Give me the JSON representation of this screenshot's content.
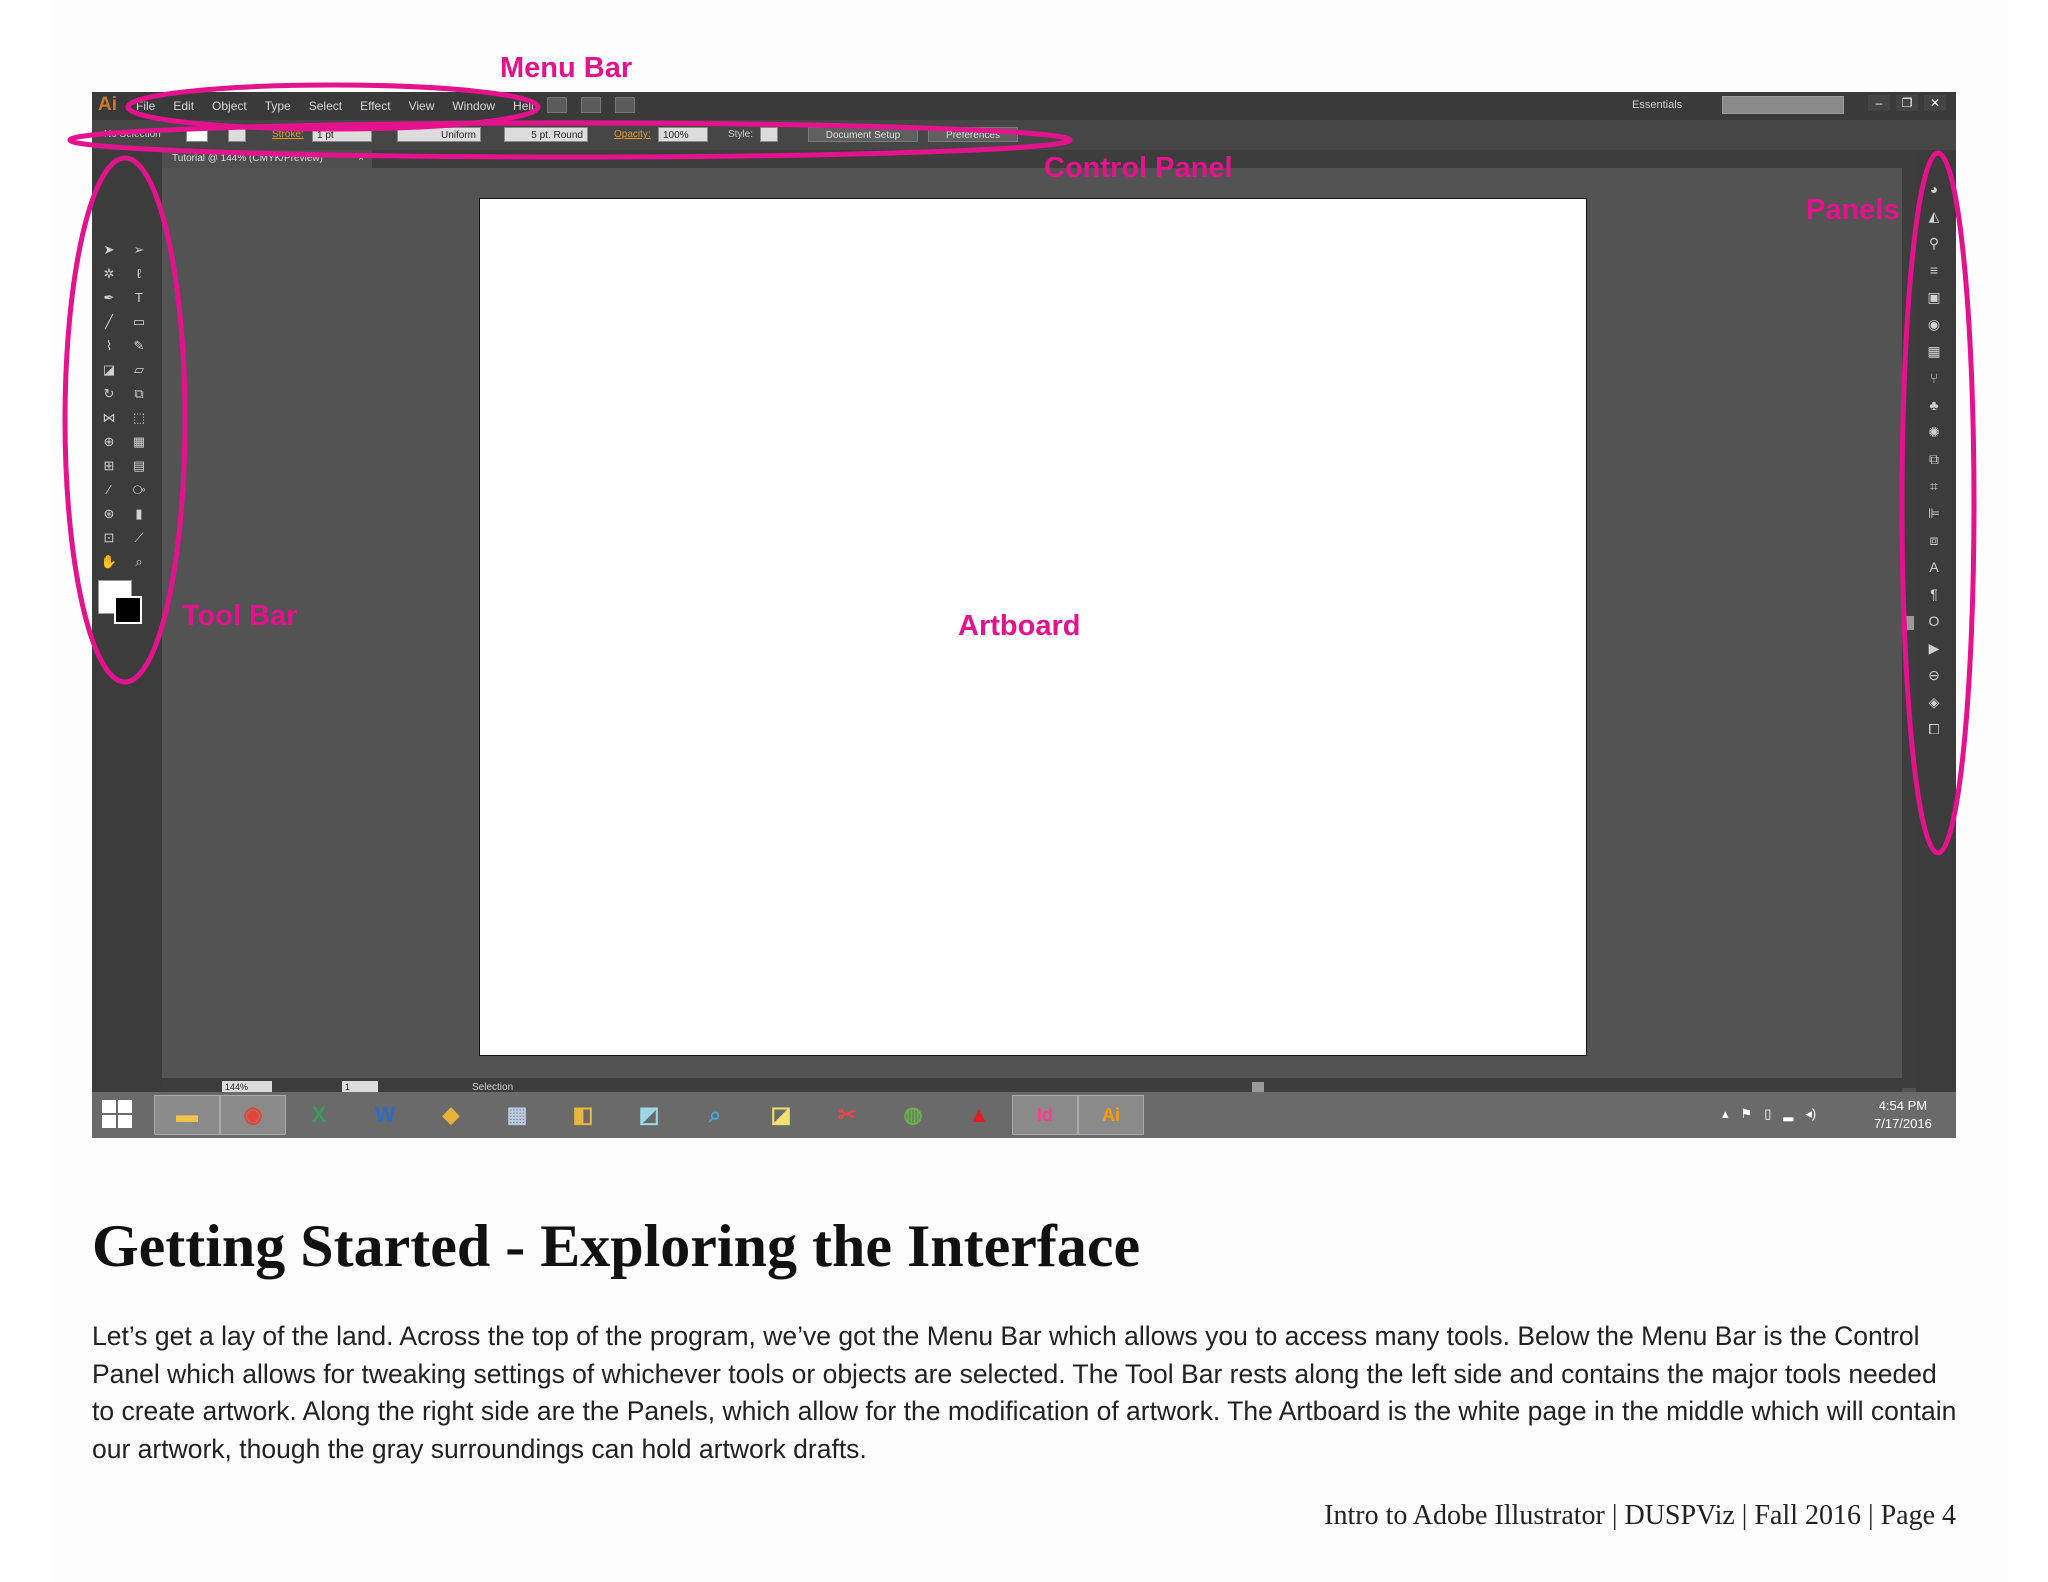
{
  "app": {
    "logo": "Ai",
    "menu_items": [
      "File",
      "Edit",
      "Object",
      "Type",
      "Select",
      "Effect",
      "View",
      "Window",
      "Help"
    ],
    "workspace": "Essentials",
    "control_panel": {
      "selection": "No Selection",
      "stroke_label": "Stroke:",
      "stroke_value": "1 pt",
      "profile": "Uniform",
      "brush": "5 pt. Round",
      "opacity_label": "Opacity:",
      "opacity_value": "100%",
      "style_label": "Style:",
      "document_setup": "Document Setup",
      "preferences": "Preferences"
    },
    "document_tab": "Tutorial @ 144% (CMYK/Preview)",
    "tab_close": "×",
    "status": {
      "zoom": "144%",
      "artboard_number": "1",
      "tool": "Selection"
    },
    "clock": {
      "time": "4:54 PM",
      "date": "7/17/2016"
    }
  },
  "annotations": {
    "menu_bar": "Menu Bar",
    "control_panel": "Control Panel",
    "panels": "Panels",
    "tool_bar": "Tool Bar",
    "artboard": "Artboard"
  },
  "annotation_color": "#e4128c",
  "heading": "Getting Started - Exploring the Interface",
  "body": "Let’s get a lay of the land. Across the top of the program, we’ve got the Menu Bar which allows you to access many tools. Below the Menu Bar is the Control Panel which allows for tweaking settings of whichever tools or objects are selected. The Tool Bar rests along the left side and contains the major tools needed to create artwork. Along the right side are the Panels, which allow for the modification of artwork. The Artboard is the white page in the middle which will contain our artwork, though the gray surroundings can hold artwork drafts.",
  "footer": "Intro to Adobe Illustrator | DUSPViz | Fall 2016 | Page 4"
}
